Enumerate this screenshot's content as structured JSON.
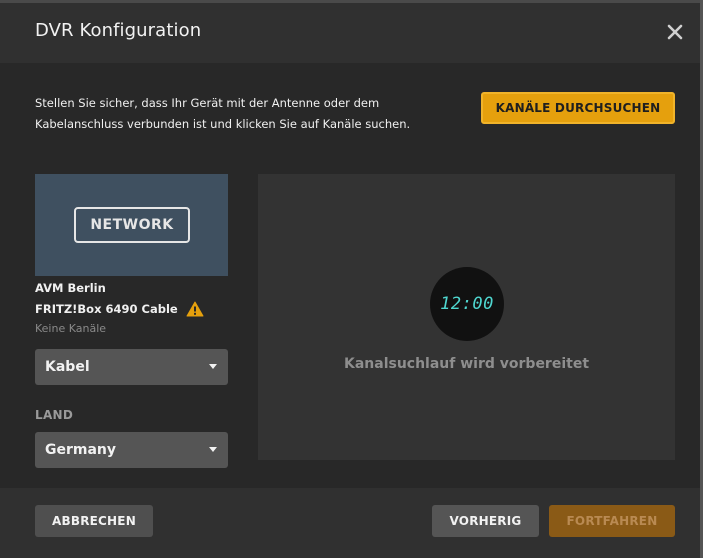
{
  "dialog": {
    "title": "DVR Konfiguration",
    "close_icon": "close-icon"
  },
  "intro": {
    "text": "Stellen Sie sicher, dass Ihr Gerät mit der Antenne oder dem Kabelanschluss verbunden ist und klicken Sie auf Kanäle suchen.",
    "scan_button_label": "KANÄLE DURCHSUCHEN"
  },
  "device": {
    "thumbnail_label": "NETWORK",
    "name": "AVM Berlin",
    "model": "FRITZ!Box 6490 Cable",
    "warning_icon": "warning-icon",
    "status": "Keine Kanäle"
  },
  "settings": {
    "type_value": "Kabel",
    "country_label": "LAND",
    "country_value": "Germany"
  },
  "scan": {
    "clock_text": "12:00",
    "status_text": "Kanalsuchlauf wird vorbereitet"
  },
  "footer": {
    "cancel_label": "ABBRECHEN",
    "previous_label": "VORHERIG",
    "next_label": "FORTFAHREN"
  },
  "colors": {
    "accent": "#e5a00d",
    "background": "#282828",
    "header": "#303030",
    "thumbnail": "#3f5060",
    "clock_digits": "#4fd7d0"
  }
}
